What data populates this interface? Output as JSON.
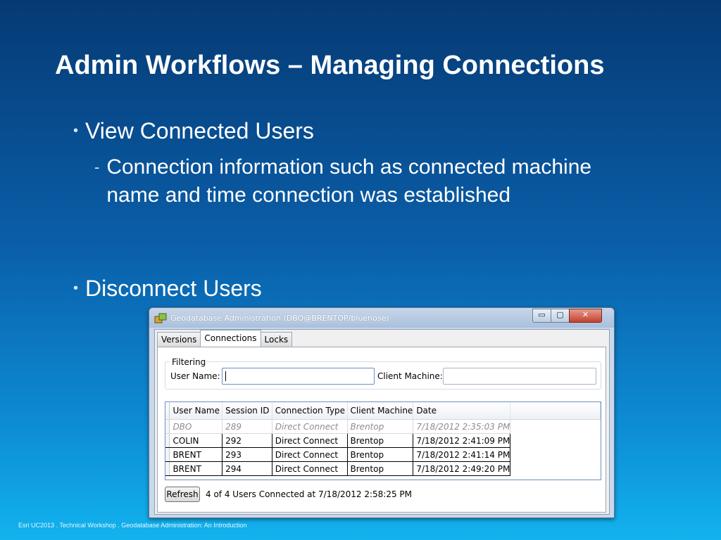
{
  "slide": {
    "title": "Admin Workflows – Managing Connections",
    "bullets": [
      {
        "text": "View Connected Users",
        "sub": "Connection information such as connected machine name and time connection was established"
      },
      {
        "text": "Disconnect Users"
      }
    ],
    "bullet_mark": "•",
    "sub_mark": "-",
    "footer": "Esri UC2013 . Technical Workshop . Geodatabase Administration: An Introduction"
  },
  "window": {
    "title": "Geodatabase Administration (DBO@BRENTOP/bluenose)",
    "controls": {
      "minimize": "▭",
      "maximize": "▢",
      "close": "✕"
    },
    "tabs": [
      "Versions",
      "Connections",
      "Locks"
    ],
    "active_tab": "Connections",
    "filtering": {
      "legend": "Filtering",
      "user_name_label": "User Name:",
      "user_name_value": "",
      "client_machine_label": "Client Machine:",
      "client_machine_value": ""
    },
    "grid": {
      "columns": [
        "User Name",
        "Session ID",
        "Connection Type",
        "Client Machine",
        "Date"
      ],
      "rows": [
        [
          "DBO",
          "289",
          "Direct Connect",
          "Brentop",
          "7/18/2012 2:35:03 PM"
        ],
        [
          "COLIN",
          "292",
          "Direct Connect",
          "Brentop",
          "7/18/2012 2:41:09 PM"
        ],
        [
          "BRENT",
          "293",
          "Direct Connect",
          "Brentop",
          "7/18/2012 2:41:14 PM"
        ],
        [
          "BRENT",
          "294",
          "Direct Connect",
          "Brentop",
          "7/18/2012 2:49:20 PM"
        ]
      ]
    },
    "refresh_label": "Refresh",
    "status": "4 of 4 Users Connected at 7/18/2012 2:58:25 PM"
  },
  "colors": {
    "accent": "#0a5ea8",
    "title_text": "#ffffff",
    "close_button": "#c2412d"
  }
}
